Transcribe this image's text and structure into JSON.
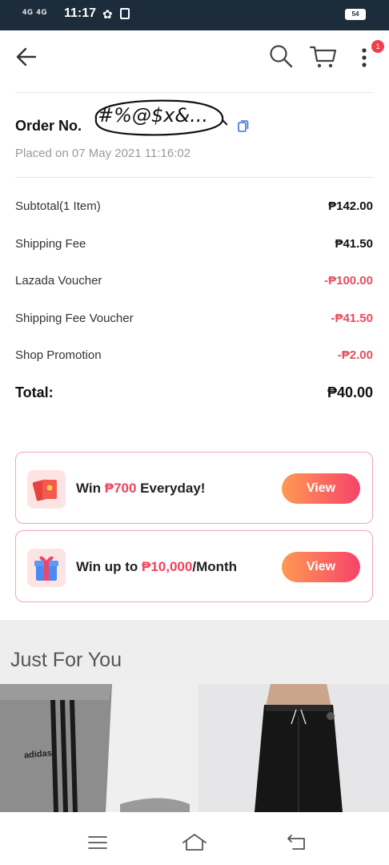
{
  "status_bar": {
    "signal_label": "4G 4G",
    "time": "11:17",
    "battery": "54"
  },
  "header": {
    "notification_count": "1"
  },
  "order": {
    "label": "Order No.",
    "redacted_number": "#%@$x&...",
    "placed_on": "Placed on 07 May 2021 11:16:02"
  },
  "summary": [
    {
      "label": "Subtotal(1 Item)",
      "value": "₱142.00"
    },
    {
      "label": "Shipping Fee",
      "value": "₱41.50"
    },
    {
      "label": "Lazada Voucher",
      "value": "-₱100.00"
    },
    {
      "label": "Shipping Fee Voucher",
      "value": "-₱41.50"
    },
    {
      "label": "Shop Promotion",
      "value": "-₱2.00"
    }
  ],
  "total": {
    "label": "Total:",
    "value": "₱40.00"
  },
  "promos": [
    {
      "prefix": "Win ",
      "amount": "₱700",
      "suffix": " Everyday!",
      "button": "View",
      "icon": "red-envelope-icon"
    },
    {
      "prefix": "Win up to ",
      "amount": "₱10,000",
      "suffix": "/Month",
      "button": "View",
      "icon": "gift-box-icon"
    }
  ],
  "just_for_you": {
    "title": "Just For You",
    "product_brand": "adidas"
  },
  "colors": {
    "accent": "#f2435c",
    "status_bar": "#1d2c3b",
    "button_gradient_start": "#fe9a53",
    "button_gradient_end": "#f6436a"
  }
}
